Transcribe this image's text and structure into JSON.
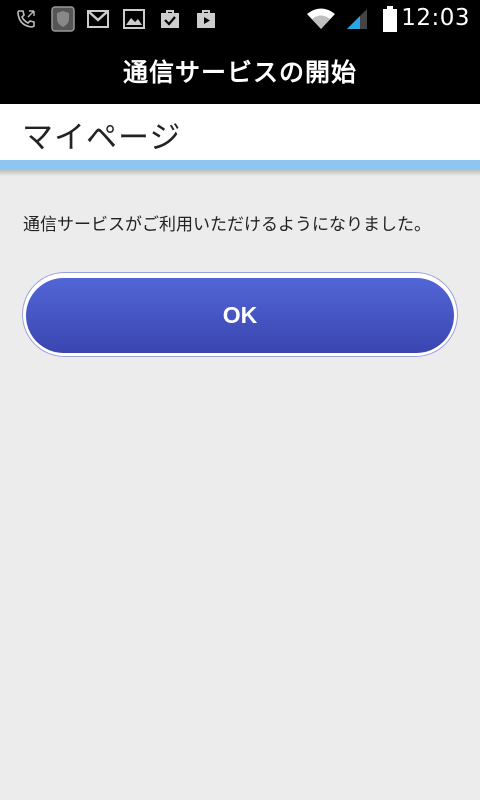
{
  "status_bar": {
    "time": "12:03",
    "icons_left": [
      "phone-icon",
      "shield-icon",
      "gmail-icon",
      "image-icon",
      "briefcase-check-icon",
      "play-store-icon"
    ],
    "icons_right": [
      "wifi-icon",
      "signal-icon",
      "battery-icon"
    ]
  },
  "title_bar": {
    "title": "通信サービスの開始"
  },
  "header": {
    "title": "マイページ",
    "accent_color": "#8dc6ee"
  },
  "main": {
    "message": "通信サービスがご利用いただけるようになりました。",
    "ok_label": "OK",
    "button_color": "#4555c4"
  }
}
